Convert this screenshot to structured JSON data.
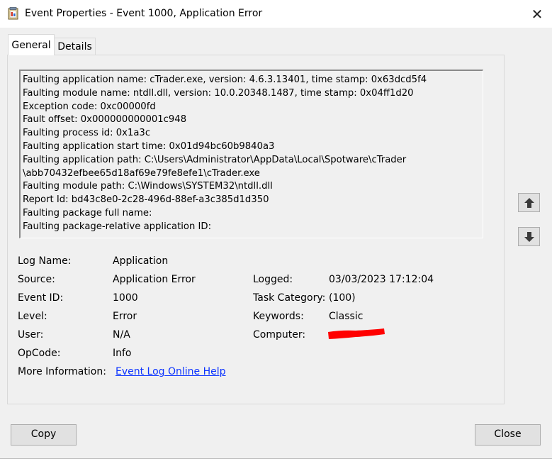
{
  "window": {
    "title": "Event Properties - Event 1000, Application Error",
    "close_glyph": "✕"
  },
  "tabs": [
    {
      "label": "General",
      "selected": true
    },
    {
      "label": "Details",
      "selected": false
    }
  ],
  "description": "Faulting application name: cTrader.exe, version: 4.6.3.13401, time stamp: 0x63dcd5f4\nFaulting module name: ntdll.dll, version: 10.0.20348.1487, time stamp: 0x04ff1d20\nException code: 0xc00000fd\nFault offset: 0x000000000001c948\nFaulting process id: 0x1a3c\nFaulting application start time: 0x01d94bc60b9840a3\nFaulting application path: C:\\Users\\Administrator\\AppData\\Local\\Spotware\\cTrader\n\\abb70432efbee65d18af69e79fe8efe1\\cTrader.exe\nFaulting module path: C:\\Windows\\SYSTEM32\\ntdll.dll\nReport Id: bd43c8e0-2c28-496d-88ef-a3c385d1d350\nFaulting package full name:\nFaulting package-relative application ID:",
  "fields": {
    "log_name_label": "Log Name:",
    "log_name_value": "Application",
    "source_label": "Source:",
    "source_value": "Application Error",
    "event_id_label": "Event ID:",
    "event_id_value": "1000",
    "level_label": "Level:",
    "level_value": "Error",
    "user_label": "User:",
    "user_value": "N/A",
    "opcode_label": "OpCode:",
    "opcode_value": "Info",
    "more_info_label": "More Information:",
    "more_info_link": "Event Log Online Help",
    "logged_label": "Logged:",
    "logged_value": "03/03/2023 17:12:04",
    "task_category_label": "Task Category:",
    "task_category_value": "(100)",
    "keywords_label": "Keywords:",
    "keywords_value": "Classic",
    "computer_label": "Computer:",
    "computer_redaction_color": "#ff0000"
  },
  "icons": {
    "app": "event-viewer-icon",
    "up": "arrow-up-icon",
    "down": "arrow-down-icon"
  },
  "buttons": {
    "copy": "Copy",
    "close": "Close"
  },
  "colors": {
    "link": "#0b33ff",
    "window_bg": "#f0f0f0",
    "redaction": "#ff0000"
  }
}
